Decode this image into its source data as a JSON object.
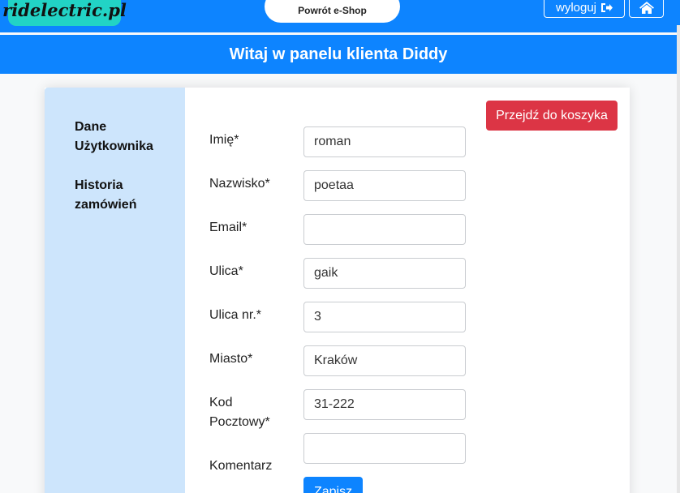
{
  "header": {
    "logo_text": "ridelectric.pl",
    "back_label": "Powrót e-Shop",
    "logout_label": "wyloguj",
    "logout_icon": "sign-out-icon",
    "home_icon": "home-icon"
  },
  "welcome": {
    "title": "Witaj w panelu klienta Diddy"
  },
  "sidebar": {
    "items": [
      {
        "label": "Dane Użytkownika"
      },
      {
        "label": "Historia zamówień"
      }
    ]
  },
  "actions": {
    "cart_label": "Przejdź do koszyka",
    "save_label": "Zapisz"
  },
  "form": {
    "fields": [
      {
        "label": "Imię*",
        "value": "roman"
      },
      {
        "label": "Nazwisko*",
        "value": "poetaa"
      },
      {
        "label": "Email*",
        "value": ""
      },
      {
        "label": "Ulica*",
        "value": "gaik"
      },
      {
        "label": "Ulica nr.*",
        "value": "3"
      },
      {
        "label": "Miasto*",
        "value": "Kraków"
      },
      {
        "label": "Kod Pocztowy*",
        "value": "31-222"
      },
      {
        "label": "Komentarz",
        "value": ""
      }
    ]
  },
  "colors": {
    "primary": "#0d84ff",
    "danger": "#dc3545",
    "sidebar": "#cde5fc",
    "logo_bg": "#22d3c5"
  }
}
